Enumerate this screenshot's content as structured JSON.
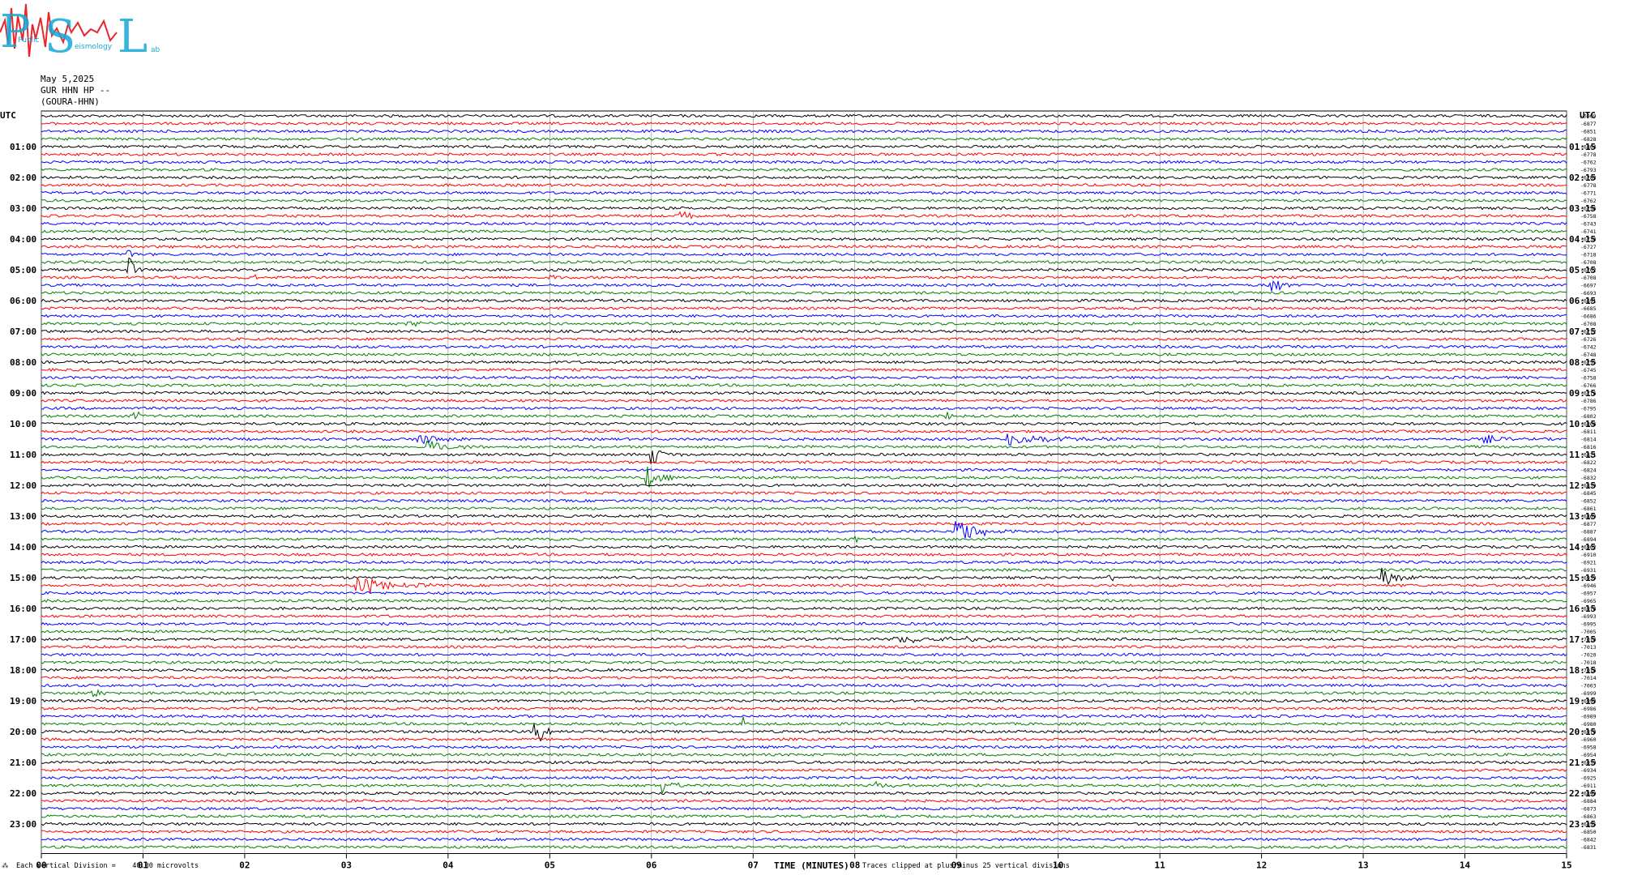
{
  "logo": {
    "letters": [
      "P",
      "S",
      "L"
    ],
    "small_text": [
      "Public",
      "eismology",
      "ab"
    ],
    "colors": {
      "letters": "#13a8d6",
      "wave": "#e8262c"
    }
  },
  "header": {
    "date": "May 5,2025",
    "station": "GUR HHN HP --",
    "site": "(GOURA-HHN)"
  },
  "left_utc_label": "UTC",
  "right_utc_label": "UTC",
  "footer": {
    "vertical_division": "Each Vertical Division =    40.00 microvolts",
    "left_mark": "⁂",
    "xaxis_title": "TIME (MINUTES)",
    "clip_note": "Traces clipped at plus/minus 25 vertical divisions"
  },
  "chart_data": {
    "type": "line",
    "title": "",
    "xlabel": "TIME (MINUTES)",
    "ylabel": "UTC",
    "xlim": [
      0,
      15
    ],
    "x_ticks": [
      "00",
      "01",
      "02",
      "03",
      "04",
      "05",
      "06",
      "07",
      "08",
      "09",
      "10",
      "11",
      "12",
      "13",
      "14",
      "15"
    ],
    "trace_minutes": 15,
    "trace_count": 96,
    "trace_colors": [
      "#000000",
      "#ff0000",
      "#0000ff",
      "#008000"
    ],
    "left_hour_labels": [
      "01:00",
      "02:00",
      "03:00",
      "04:00",
      "05:00",
      "06:00",
      "07:00",
      "08:00",
      "09:00",
      "10:00",
      "11:00",
      "12:00",
      "13:00",
      "14:00",
      "15:00",
      "16:00",
      "17:00",
      "18:00",
      "19:00",
      "20:00",
      "21:00",
      "22:00",
      "23:00"
    ],
    "right_hour_labels": [
      "01:15",
      "02:15",
      "03:15",
      "04:15",
      "05:15",
      "06:15",
      "07:15",
      "08:15",
      "09:15",
      "10:15",
      "11:15",
      "12:15",
      "13:15",
      "14:15",
      "15:15",
      "16:15",
      "17:15",
      "18:15",
      "19:15",
      "20:15",
      "21:15",
      "22:15",
      "23:15"
    ],
    "trace_offsets": [
      "-6909",
      "-6877",
      "-6851",
      "-6828",
      "-6804",
      "-6778",
      "-6762",
      "-6793",
      "-6783",
      "-6778",
      "-6771",
      "-6762",
      "-6756",
      "-6758",
      "-6743",
      "-6741",
      "-6730",
      "-6727",
      "-6718",
      "-6708",
      "-6702",
      "-6708",
      "-6697",
      "-6693",
      "-6691",
      "-6685",
      "-6686",
      "-6708",
      "-6712",
      "-6726",
      "-6742",
      "-6748",
      "-6755",
      "-6745",
      "-6758",
      "-6766",
      "-6776",
      "-6786",
      "-6795",
      "-6802",
      "-6806",
      "-6811",
      "-6814",
      "-6816",
      "-6821",
      "-6822",
      "-6824",
      "-6832",
      "-6839",
      "-6845",
      "-6852",
      "-6861",
      "-6869",
      "-6877",
      "-6887",
      "-6894",
      "-6902",
      "-6910",
      "-6921",
      "-6931",
      "-6939",
      "-6946",
      "-6957",
      "-6965",
      "-6978",
      "-6993",
      "-6995",
      "-7005",
      "-7010",
      "-7013",
      "-7020",
      "-7018",
      "-7016",
      "-7014",
      "-7003",
      "-6999",
      "-6993",
      "-6986",
      "-6989",
      "-6980",
      "-6970",
      "-6960",
      "-6958",
      "-6954",
      "-6939",
      "-6934",
      "-6925",
      "-6911",
      "-6899",
      "-6884",
      "-6873",
      "-6863",
      "-6855",
      "-6850",
      "-6842",
      "-6831"
    ],
    "events": [
      {
        "trace": 20,
        "minute": 0.85,
        "amp": 25,
        "dur": 0.15
      },
      {
        "trace": 18,
        "minute": 0.85,
        "amp": 6,
        "dur": 0.2
      },
      {
        "trace": 39,
        "minute": 0.9,
        "amp": 6,
        "dur": 0.3
      },
      {
        "trace": 13,
        "minute": 6.3,
        "amp": 6,
        "dur": 0.3
      },
      {
        "trace": 21,
        "minute": 2.1,
        "amp": 3,
        "dur": 0.3
      },
      {
        "trace": 21,
        "minute": 5.0,
        "amp": 3,
        "dur": 0.2
      },
      {
        "trace": 21,
        "minute": 13.8,
        "amp": 3,
        "dur": 0.3
      },
      {
        "trace": 19,
        "minute": 8.6,
        "amp": 3,
        "dur": 0.2
      },
      {
        "trace": 19,
        "minute": 13.2,
        "amp": 4,
        "dur": 0.2
      },
      {
        "trace": 22,
        "minute": 12.1,
        "amp": 10,
        "dur": 0.4
      },
      {
        "trace": 27,
        "minute": 3.6,
        "amp": 4,
        "dur": 0.6
      },
      {
        "trace": 44,
        "minute": 6.0,
        "amp": 14,
        "dur": 0.3
      },
      {
        "trace": 47,
        "minute": 5.95,
        "amp": 18,
        "dur": 0.3
      },
      {
        "trace": 42,
        "minute": 3.7,
        "amp": 8,
        "dur": 0.6
      },
      {
        "trace": 42,
        "minute": 9.5,
        "amp": 9,
        "dur": 1.2
      },
      {
        "trace": 43,
        "minute": 3.8,
        "amp": 9,
        "dur": 0.6
      },
      {
        "trace": 42,
        "minute": 14.2,
        "amp": 5,
        "dur": 0.5
      },
      {
        "trace": 39,
        "minute": 8.9,
        "amp": 6,
        "dur": 0.2
      },
      {
        "trace": 54,
        "minute": 9.0,
        "amp": 16,
        "dur": 0.7
      },
      {
        "trace": 55,
        "minute": 8.0,
        "amp": 8,
        "dur": 0.2
      },
      {
        "trace": 61,
        "minute": 3.1,
        "amp": 12,
        "dur": 0.9
      },
      {
        "trace": 60,
        "minute": 13.2,
        "amp": 12,
        "dur": 0.5
      },
      {
        "trace": 60,
        "minute": 10.5,
        "amp": 4,
        "dur": 0.3
      },
      {
        "trace": 68,
        "minute": 8.4,
        "amp": 5,
        "dur": 2.6
      },
      {
        "trace": 80,
        "minute": 4.85,
        "amp": 25,
        "dur": 0.25
      },
      {
        "trace": 79,
        "minute": 6.9,
        "amp": 8,
        "dur": 0.2
      },
      {
        "trace": 82,
        "minute": 3.1,
        "amp": 4,
        "dur": 0.3
      },
      {
        "trace": 87,
        "minute": 6.1,
        "amp": 14,
        "dur": 0.3
      },
      {
        "trace": 87,
        "minute": 8.2,
        "amp": 5,
        "dur": 0.5
      },
      {
        "trace": 75,
        "minute": 0.5,
        "amp": 5,
        "dur": 0.3
      },
      {
        "trace": 80,
        "minute": 11.0,
        "amp": 4,
        "dur": 0.1
      },
      {
        "trace": 80,
        "minute": 12.2,
        "amp": 4,
        "dur": 0.1
      }
    ]
  }
}
